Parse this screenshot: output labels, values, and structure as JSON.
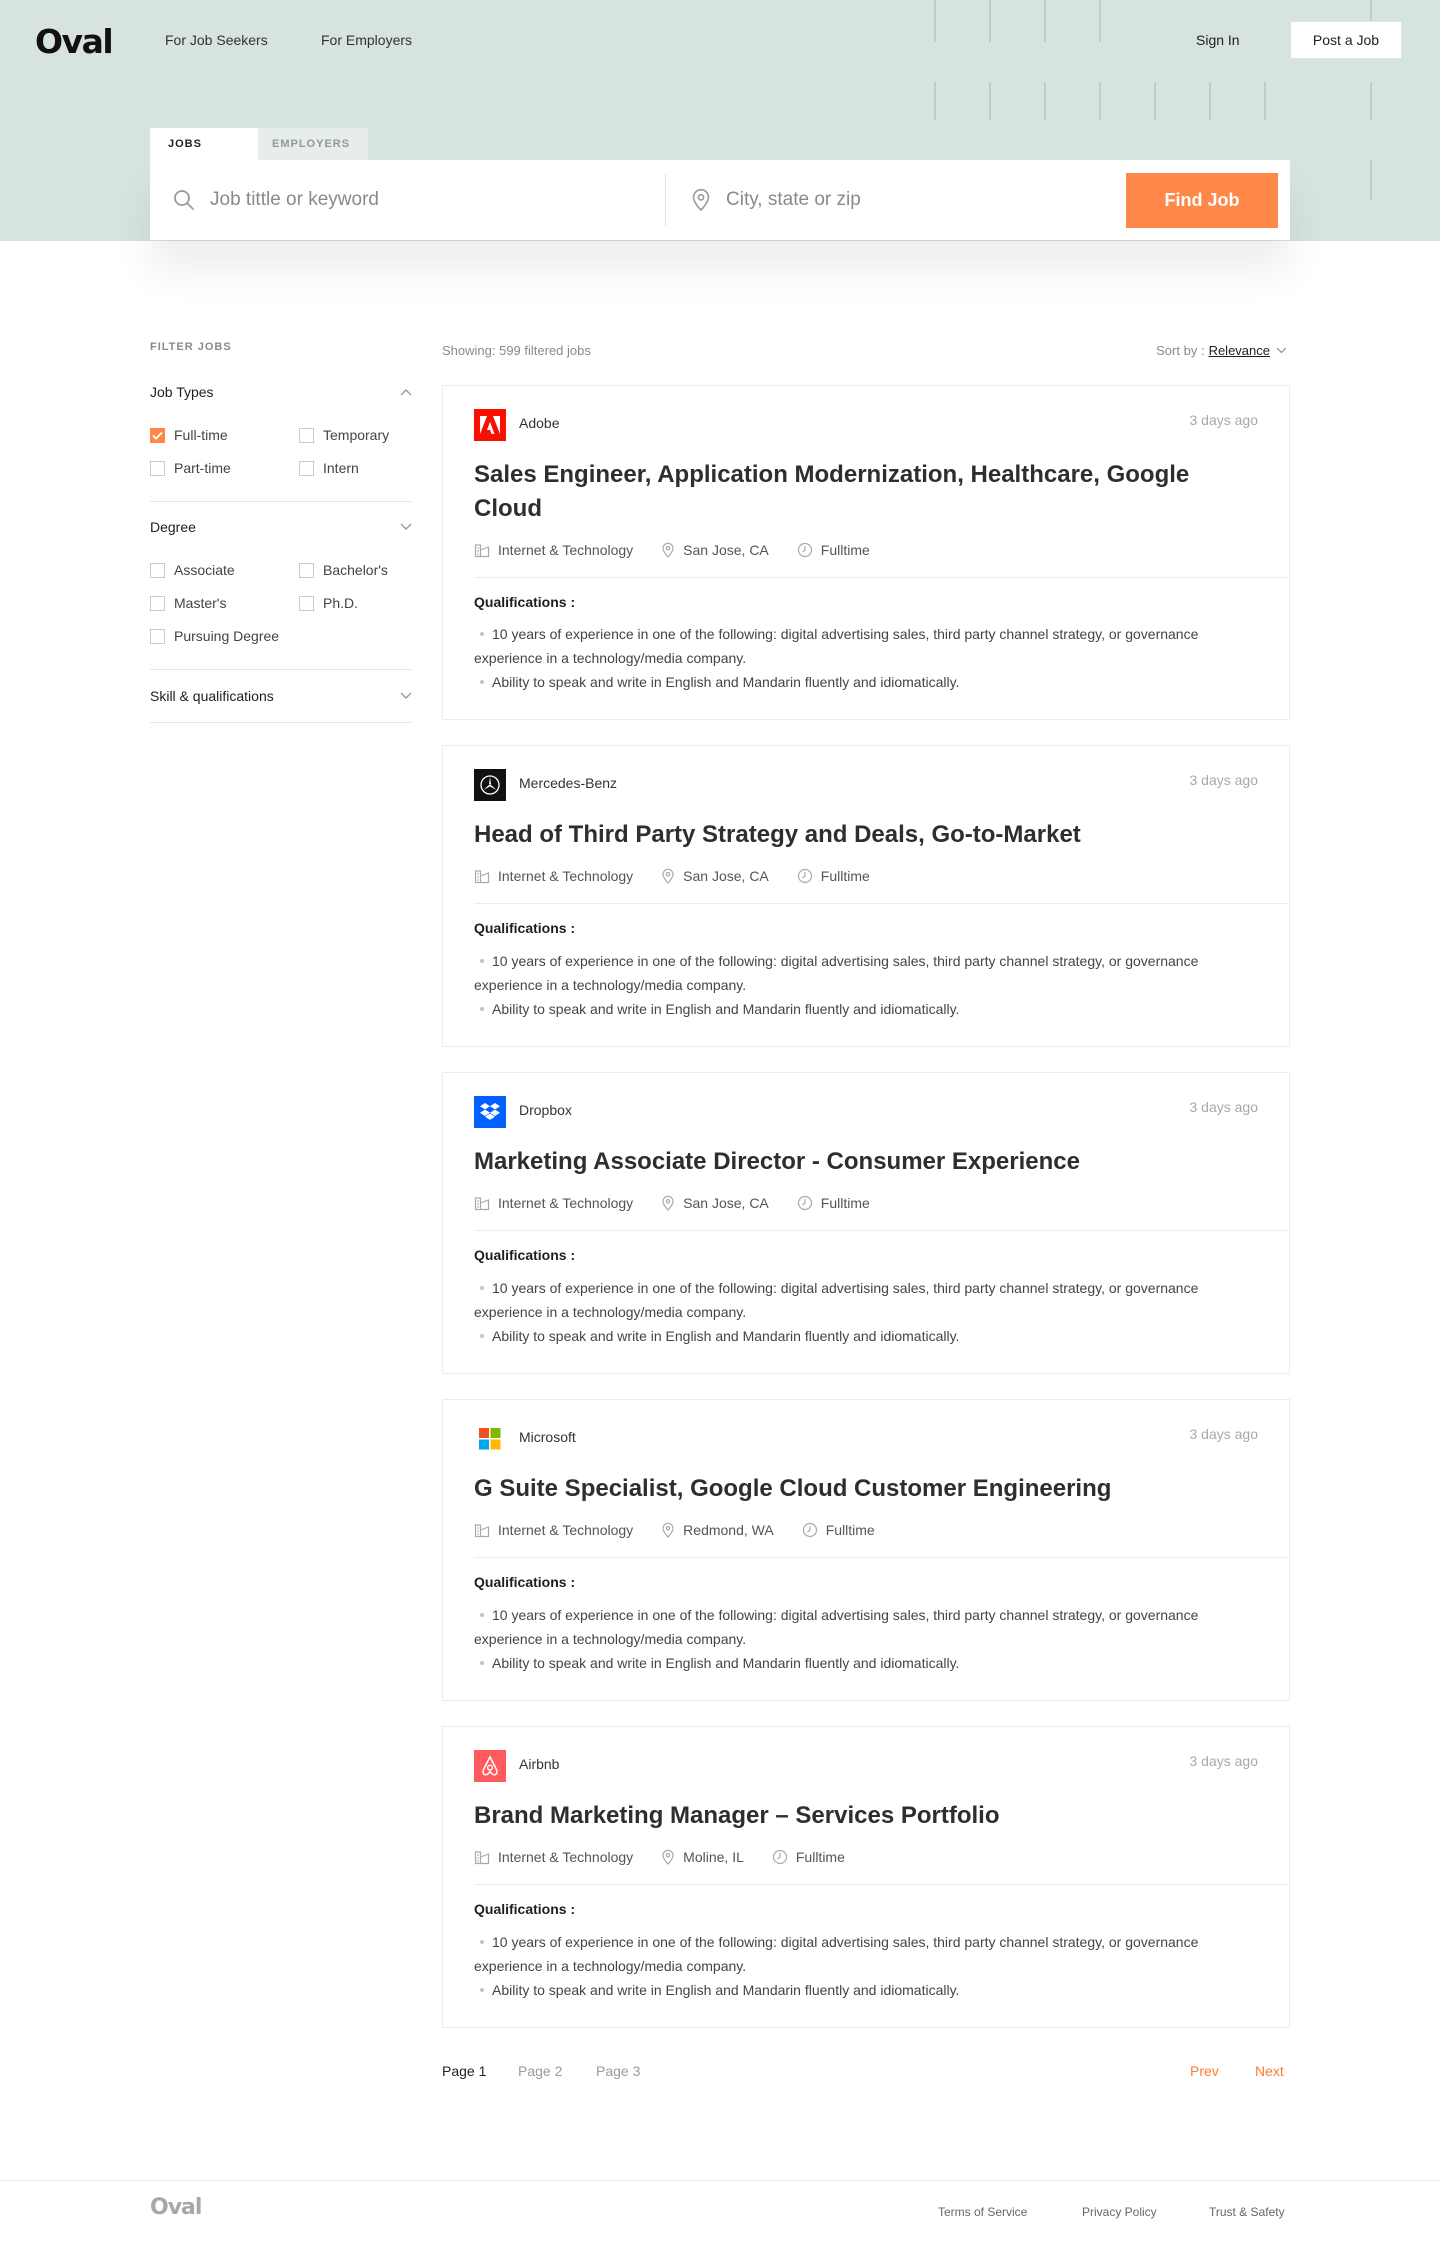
{
  "brand": {
    "logo": "Oval",
    "accent": "#ff8848",
    "hero_bg": "#d6e3df"
  },
  "nav": {
    "job_seekers": "For Job Seekers",
    "employers": "For Employers",
    "sign_in": "Sign In",
    "post_job": "Post a Job"
  },
  "search": {
    "tabs": [
      "JOBS",
      "EMPLOYERS"
    ],
    "active_tab": "JOBS",
    "keyword_placeholder": "Job tittle or keyword",
    "location_placeholder": "City, state or zip",
    "button": "Find Job",
    "icons": [
      "search-icon",
      "location-pin-icon"
    ]
  },
  "filters": {
    "title": "FILTER JOBS",
    "job_types": {
      "label": "Job Types",
      "expanded": true,
      "options": [
        {
          "label": "Full-time",
          "checked": true
        },
        {
          "label": "Temporary",
          "checked": false
        },
        {
          "label": "Part-time",
          "checked": false
        },
        {
          "label": "Intern",
          "checked": false
        }
      ]
    },
    "degree": {
      "label": "Degree",
      "expanded": true,
      "options": [
        {
          "label": "Associate",
          "checked": false
        },
        {
          "label": "Bachelor's",
          "checked": false
        },
        {
          "label": "Master's",
          "checked": false
        },
        {
          "label": "Ph.D.",
          "checked": false
        },
        {
          "label": "Pursuing Degree",
          "checked": false
        }
      ]
    },
    "skills": {
      "label": "Skill & qualifications",
      "expanded": false
    }
  },
  "results": {
    "showing": "Showing: 599 filtered jobs",
    "sort_label": "Sort by :",
    "sort_value": "Relevance",
    "jobs": [
      {
        "company": "Adobe",
        "logo_color": "#fa0f00",
        "posted": "3 days ago",
        "title": "Sales Engineer, Application Modernization, Healthcare, Google Cloud",
        "industry": "Internet & Technology",
        "location": "San Jose, CA",
        "type": "Fulltime",
        "qual_title": "Qualifications :",
        "bullets": [
          "10 years of experience in one of the following: digital advertising sales, third party channel strategy, or governance experience in a technology/media company.",
          "Ability to speak and write in English and Mandarin fluently and idiomatically."
        ]
      },
      {
        "company": "Mercedes-Benz",
        "logo_color": "#111111",
        "posted": "3 days ago",
        "title": "Head of Third Party Strategy and Deals, Go-to-Market",
        "industry": "Internet & Technology",
        "location": "San Jose, CA",
        "type": "Fulltime",
        "qual_title": "Qualifications :",
        "bullets": [
          "10 years of experience in one of the following: digital advertising sales, third party channel strategy, or governance experience in a technology/media company.",
          "Ability to speak and write in English and Mandarin fluently and idiomatically."
        ]
      },
      {
        "company": "Dropbox",
        "logo_color": "#0061fe",
        "posted": "3 days ago",
        "title": "Marketing Associate Director - Consumer Experience",
        "industry": "Internet & Technology",
        "location": "San Jose, CA",
        "type": "Fulltime",
        "qual_title": "Qualifications :",
        "bullets": [
          "10 years of experience in one of the following: digital advertising sales, third party channel strategy, or governance experience in a technology/media company.",
          "Ability to speak and write in English and Mandarin fluently and idiomatically."
        ]
      },
      {
        "company": "Microsoft",
        "logo_color": "#f25022",
        "posted": "3 days ago",
        "title": "G Suite Specialist, Google Cloud Customer Engineering",
        "industry": "Internet & Technology",
        "location": "Redmond, WA",
        "type": "Fulltime",
        "qual_title": "Qualifications :",
        "bullets": [
          "10 years of experience in one of the following: digital advertising sales, third party channel strategy, or governance experience in a technology/media company.",
          "Ability to speak and write in English and Mandarin fluently and idiomatically."
        ]
      },
      {
        "company": "Airbnb",
        "logo_color": "#ff5a5f",
        "posted": "3 days ago",
        "title": "Brand Marketing Manager – Services Portfolio",
        "industry": "Internet & Technology",
        "location": "Moline, IL",
        "type": "Fulltime",
        "qual_title": "Qualifications :",
        "bullets": [
          "10 years of experience in one of the following: digital advertising sales, third party channel strategy, or governance experience in a technology/media company.",
          "Ability to speak and write in English and Mandarin fluently and idiomatically."
        ]
      }
    ]
  },
  "pagination": {
    "pages": [
      "Page 1",
      "Page 2",
      "Page 3"
    ],
    "current": "Page 1",
    "prev": "Prev",
    "next": "Next"
  },
  "footer": {
    "logo": "Oval",
    "links": [
      "Terms of Service",
      "Privacy Policy",
      "Trust & Safety"
    ]
  }
}
